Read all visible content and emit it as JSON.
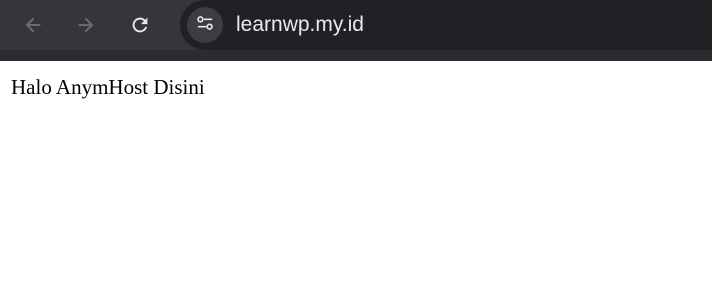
{
  "browser": {
    "url": "learnwp.my.id",
    "icons": {
      "back": "arrow-left-icon",
      "forward": "arrow-right-icon",
      "reload": "reload-icon",
      "site_info": "tune-icon"
    },
    "colors": {
      "toolbar_bg": "#35363a",
      "omnibox_bg": "#202124",
      "url_text": "#e8eaed"
    }
  },
  "page": {
    "body_text": "Halo AnymHost Disini"
  }
}
